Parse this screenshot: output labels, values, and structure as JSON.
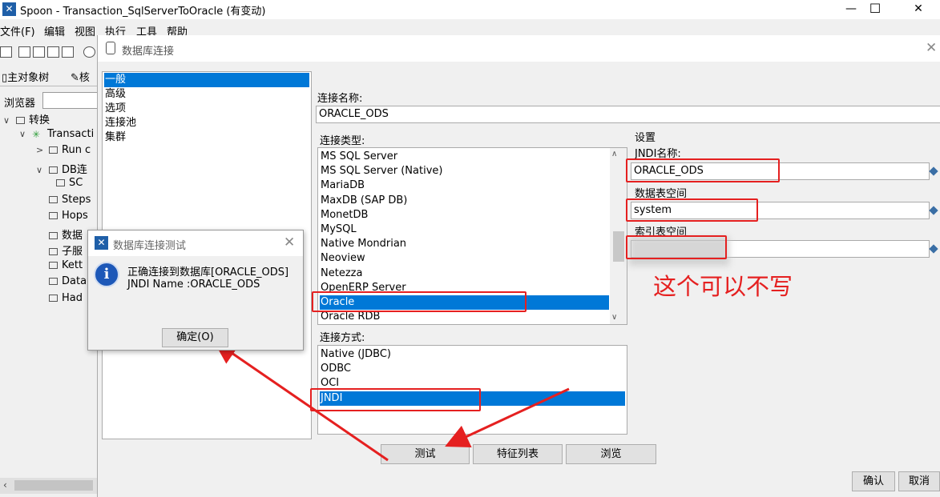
{
  "window": {
    "title": "Spoon - Transaction_SqlServerToOracle (有变动)",
    "controls": {
      "minimize": "—",
      "maximize": "☐",
      "close": "✕"
    }
  },
  "menu": [
    "文件(F)",
    "编辑",
    "视图",
    "执行",
    "工具",
    "帮助"
  ],
  "left_panel": {
    "tabs": [
      "主对象树",
      "核"
    ],
    "browser_label": "浏览器",
    "tree": [
      {
        "label": "转换",
        "level": 0,
        "chevron": "∨"
      },
      {
        "label": "Transacti",
        "level": 1,
        "chevron": "∨"
      },
      {
        "label": "Run c",
        "level": 2,
        "chevron": ">"
      },
      {
        "label": "DB连",
        "level": 2,
        "chevron": "∨"
      },
      {
        "label": "SC",
        "level": 3,
        "chevron": ""
      },
      {
        "label": "Steps",
        "level": 2,
        "chevron": ""
      },
      {
        "label": "Hops",
        "level": 2,
        "chevron": ""
      },
      {
        "label": "数据",
        "level": 2,
        "chevron": ""
      },
      {
        "label": "子服",
        "level": 2,
        "chevron": ""
      },
      {
        "label": "Kett",
        "level": 2,
        "chevron": ""
      },
      {
        "label": "Data",
        "level": 2,
        "chevron": ""
      },
      {
        "label": "Had",
        "level": 2,
        "chevron": ""
      }
    ]
  },
  "db_dialog": {
    "title": "数据库连接",
    "categories": [
      "一般",
      "高级",
      "选项",
      "连接池",
      "集群"
    ],
    "selected_category": "一般",
    "connection_name_label": "连接名称:",
    "connection_name_value": "ORACLE_ODS",
    "connection_type_label": "连接类型:",
    "connection_types": [
      "MS SQL Server",
      "MS SQL Server (Native)",
      "MariaDB",
      "MaxDB (SAP DB)",
      "MonetDB",
      "MySQL",
      "Native Mondrian",
      "Neoview",
      "Netezza",
      "OpenERP Server",
      "Oracle",
      "Oracle RDB"
    ],
    "selected_type": "Oracle",
    "access_label": "连接方式:",
    "access_methods": [
      "Native (JDBC)",
      "ODBC",
      "OCI",
      "JNDI"
    ],
    "selected_access": "JNDI",
    "settings": {
      "group_label": "设置",
      "jndi_label": "JNDI名称:",
      "jndi_value": "ORACLE_ODS",
      "data_ts_label": "数据表空间",
      "data_ts_value": "system",
      "index_ts_label": "索引表空间",
      "index_ts_value": ""
    },
    "buttons": {
      "test": "测试",
      "features": "特征列表",
      "explore": "浏览",
      "ok": "确认",
      "cancel": "取消"
    }
  },
  "annotation": {
    "text": "这个可以不写",
    "color": "#e52020"
  },
  "test_dialog": {
    "title": "数据库连接测试",
    "line1": "正确连接到数据库[ORACLE_ODS]",
    "line2": "JNDI Name :ORACLE_ODS",
    "ok_button": "确定(O)"
  },
  "colors": {
    "selection": "#0078d7",
    "annotation": "#e52020"
  }
}
